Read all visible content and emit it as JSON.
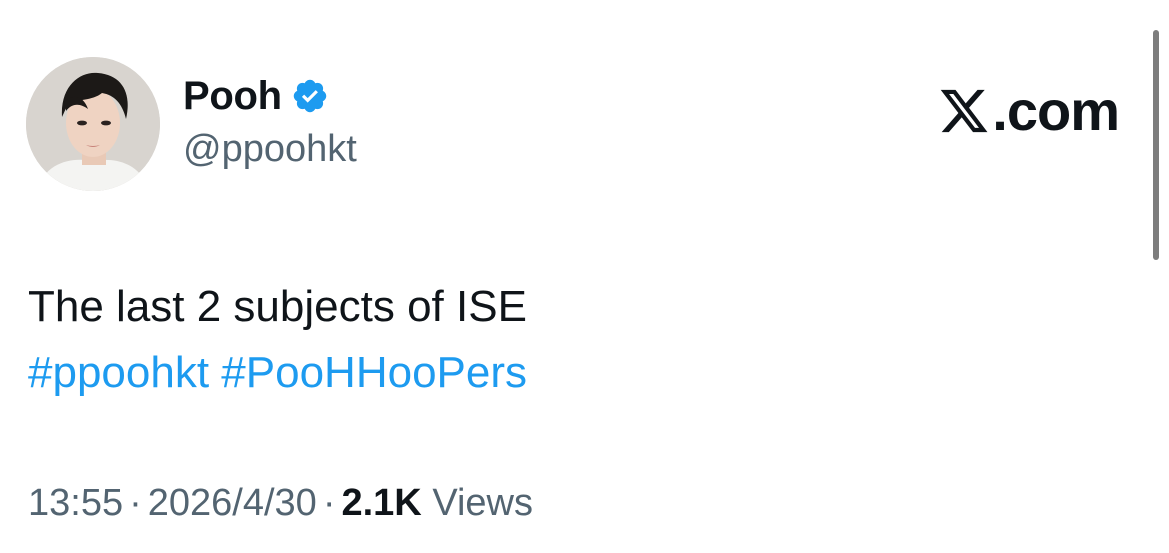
{
  "author": {
    "display_name": "Pooh",
    "handle": "@ppoohkt",
    "verified": true,
    "avatar_icon": "avatar-photo"
  },
  "brand": {
    "label": ".com",
    "icon": "x-logo-icon"
  },
  "tweet": {
    "text": "The last 2 subjects of ISE",
    "hashtags": [
      "#ppoohkt",
      "#PooHHooPers"
    ]
  },
  "meta": {
    "time": "13:55",
    "date": "2026/4/30",
    "views_count": "2.1K",
    "views_label": "Views",
    "separator": "·"
  },
  "colors": {
    "text_primary": "#0f1419",
    "text_secondary": "#536471",
    "link": "#1d9bf0",
    "verified_badge": "#1d9bf0"
  }
}
